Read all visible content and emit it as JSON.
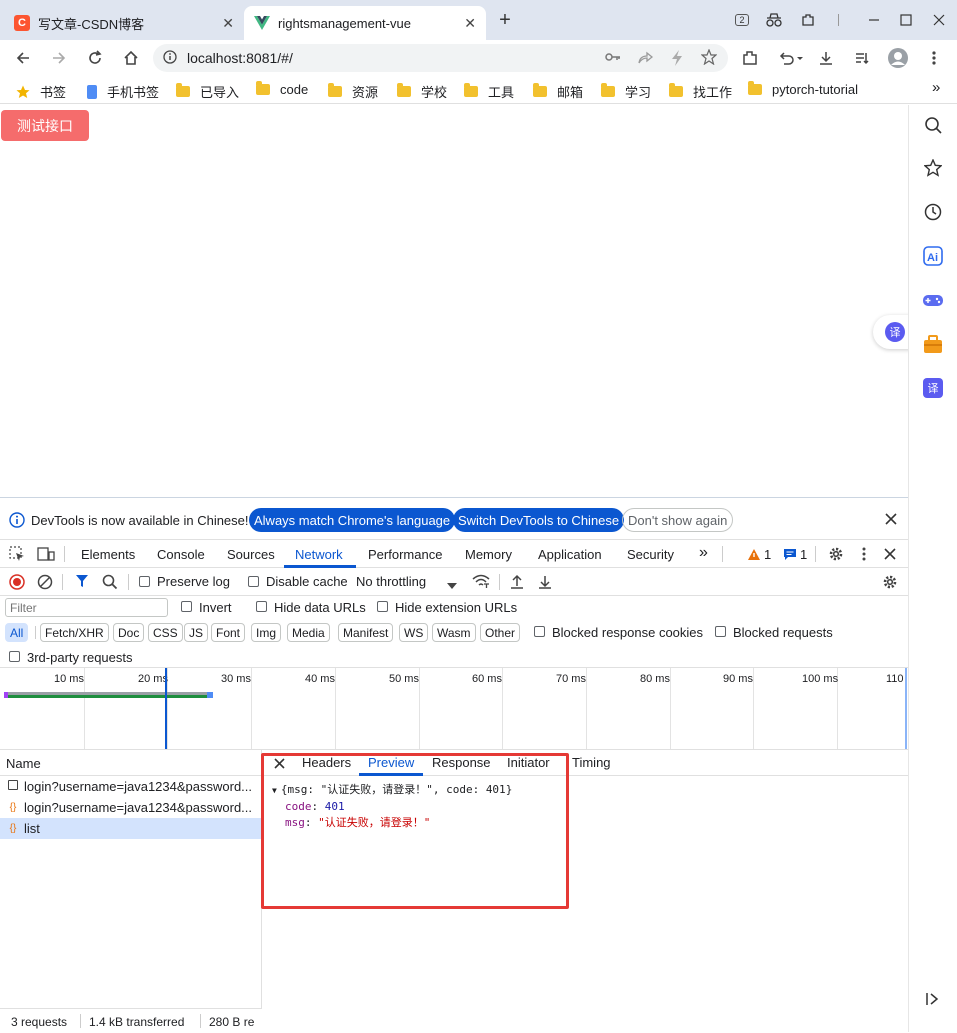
{
  "tabs": [
    {
      "title": "写文章-CSDN博客",
      "favicon": "C",
      "close": "✕"
    },
    {
      "title": "rightsmanagement-vue",
      "close": "✕"
    }
  ],
  "new_tab": "+",
  "tab_counter": "2",
  "omnibox": {
    "url": "localhost:8081/#/"
  },
  "bookmarks": [
    "书签",
    "手机书签",
    "已导入",
    "code",
    "资源",
    "学校",
    "工具",
    "邮箱",
    "学习",
    "找工作",
    "pytorch-tutorial"
  ],
  "bookmarks_more": "»",
  "page": {
    "test_button": "测试接口"
  },
  "floating_translate": "译",
  "devtools": {
    "info": {
      "message": "DevTools is now available in Chinese!",
      "always_match": "Always match Chrome's language",
      "switch": "Switch DevTools to Chinese",
      "dont_show": "Don't show again"
    },
    "tabs": [
      "Elements",
      "Console",
      "Sources",
      "Network",
      "Performance",
      "Memory",
      "Application",
      "Security"
    ],
    "more_tabs": "»",
    "warnings": "1",
    "messages": "1",
    "network": {
      "preserve_log": "Preserve log",
      "disable_cache": "Disable cache",
      "throttling": "No throttling",
      "filter_placeholder": "Filter",
      "invert": "Invert",
      "hide_data_urls": "Hide data URLs",
      "hide_extension_urls": "Hide extension URLs",
      "types": [
        "All",
        "Fetch/XHR",
        "Doc",
        "CSS",
        "JS",
        "Font",
        "Img",
        "Media",
        "Manifest",
        "WS",
        "Wasm",
        "Other"
      ],
      "blocked_cookies": "Blocked response cookies",
      "blocked_requests": "Blocked requests",
      "third_party": "3rd-party requests",
      "timeline_ticks": [
        "10 ms",
        "20 ms",
        "30 ms",
        "40 ms",
        "50 ms",
        "60 ms",
        "70 ms",
        "80 ms",
        "90 ms",
        "100 ms",
        "110"
      ],
      "name_header": "Name",
      "requests": [
        {
          "name": "login?username=java1234&password..."
        },
        {
          "name": "login?username=java1234&password..."
        },
        {
          "name": "list"
        }
      ],
      "status": {
        "requests": "3 requests",
        "transferred": "1.4 kB transferred",
        "resources": "280 B re"
      }
    },
    "detail_tabs": [
      "Headers",
      "Preview",
      "Response",
      "Initiator",
      "Timing"
    ],
    "preview": {
      "summary_open": "{msg: ",
      "summary_msg": "\"认证失败，请登录！\"",
      "summary_mid": ", code: ",
      "summary_code": "401",
      "summary_close": "}",
      "code_key": "code",
      "code_value": "401",
      "msg_key": "msg",
      "msg_value": "\"认证失败，请登录！\""
    }
  },
  "colors": {
    "accent": "#0b57d0",
    "danger_button": "#f56c6c",
    "highlight_box": "#e53935"
  }
}
